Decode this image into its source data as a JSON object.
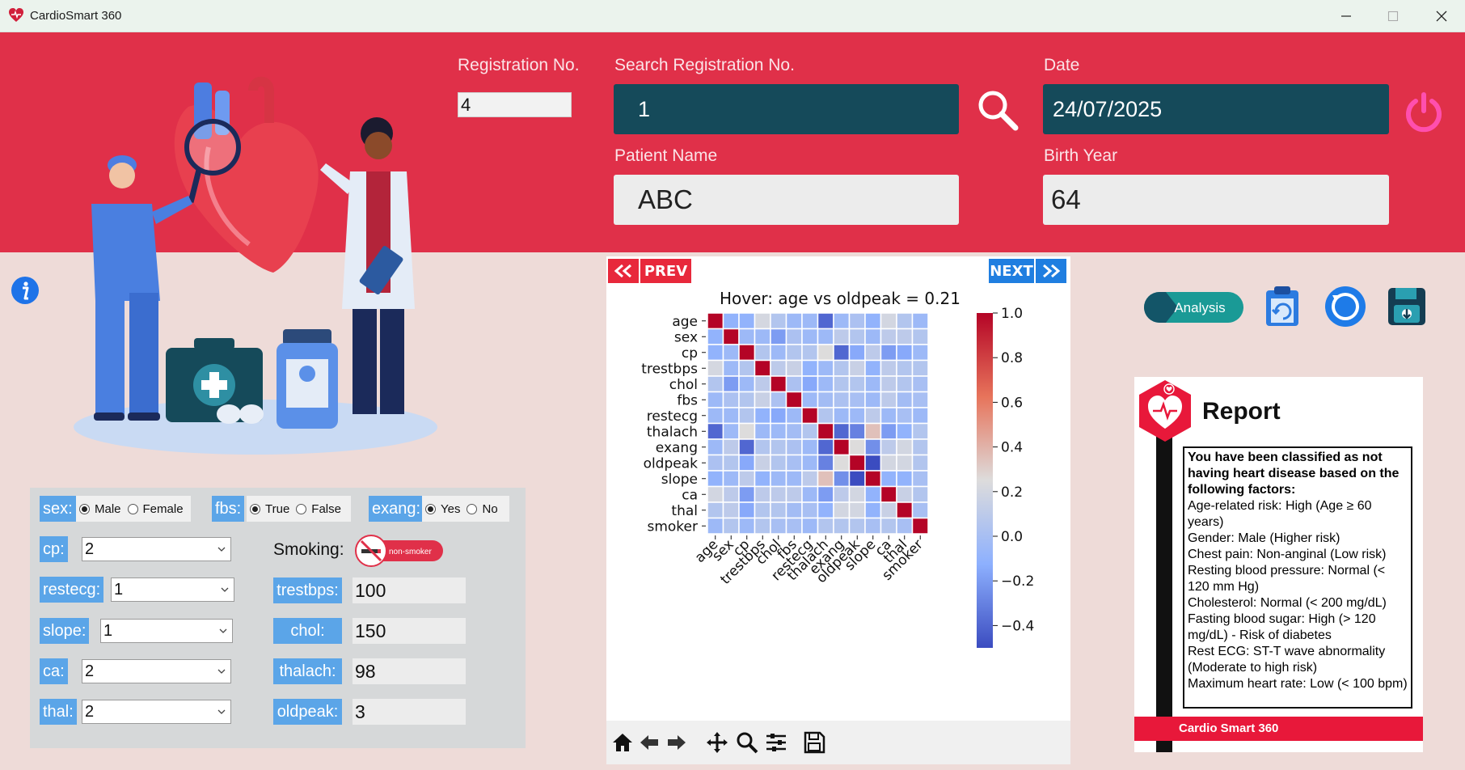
{
  "window": {
    "title": "CardioSmart 360"
  },
  "header": {
    "registration_label": "Registration No.",
    "registration_value": "4",
    "search_label": "Search Registration No.",
    "search_value": "1",
    "date_label": "Date",
    "date_value": "24/07/2025",
    "patient_name_label": "Patient Name",
    "patient_name_value": "ABC",
    "birth_year_label": "Birth Year",
    "birth_year_value": "64"
  },
  "form": {
    "sex": {
      "label": "sex:",
      "options": [
        "Male",
        "Female"
      ],
      "selected": "Male"
    },
    "fbs": {
      "label": "fbs:",
      "options": [
        "True",
        "False"
      ],
      "selected": "True"
    },
    "exang": {
      "label": "exang:",
      "options": [
        "Yes",
        "No"
      ],
      "selected": "Yes"
    },
    "cp": {
      "label": "cp:",
      "value": "2"
    },
    "restecg": {
      "label": "restecg:",
      "value": "1"
    },
    "slope": {
      "label": "slope:",
      "value": "1"
    },
    "ca": {
      "label": "ca:",
      "value": "2"
    },
    "thal": {
      "label": "thal:",
      "value": "2"
    },
    "smoking": {
      "label": "Smoking:",
      "toggle_text": "non-smoker"
    },
    "trestbps": {
      "label": "trestbps:",
      "value": "100"
    },
    "chol": {
      "label": "chol:",
      "value": "150"
    },
    "thalach": {
      "label": "thalach:",
      "value": "98"
    },
    "oldpeak": {
      "label": "oldpeak:",
      "value": "3"
    }
  },
  "chart_nav": {
    "prev_label": "PREV",
    "next_label": "NEXT"
  },
  "chart_data": {
    "type": "heatmap",
    "title": "Hover: age vs oldpeak = 0.21",
    "labels": [
      "age",
      "sex",
      "cp",
      "trestbps",
      "chol",
      "fbs",
      "restecg",
      "thalach",
      "exang",
      "oldpeak",
      "slope",
      "ca",
      "thal",
      "smoker"
    ],
    "colorbar_ticks": [
      "1.0",
      "0.8",
      "0.6",
      "0.4",
      "0.2",
      "0.0",
      "−0.2",
      "−0.4"
    ],
    "vmin": -0.5,
    "vmax": 1.0,
    "colormap": "coolwarm",
    "matrix": [
      [
        1.0,
        -0.1,
        -0.1,
        0.21,
        0.05,
        -0.05,
        -0.05,
        -0.4,
        -0.05,
        0.02,
        -0.1,
        0.2,
        0.05,
        -0.05
      ],
      [
        -0.1,
        1.0,
        -0.05,
        -0.05,
        -0.2,
        0.02,
        -0.05,
        -0.05,
        0.1,
        0.05,
        -0.05,
        0.1,
        0.1,
        0.05
      ],
      [
        -0.1,
        -0.05,
        1.0,
        0.05,
        -0.05,
        0.05,
        0.05,
        0.25,
        -0.4,
        -0.15,
        0.1,
        -0.2,
        -0.15,
        -0.05
      ],
      [
        0.21,
        -0.05,
        0.05,
        1.0,
        0.1,
        0.15,
        -0.1,
        -0.05,
        0.05,
        0.15,
        -0.1,
        0.1,
        0.05,
        0.05
      ],
      [
        0.05,
        -0.2,
        -0.05,
        0.1,
        1.0,
        0.02,
        -0.15,
        -0.05,
        0.05,
        0.05,
        -0.05,
        0.1,
        0.05,
        0.0
      ],
      [
        -0.05,
        0.02,
        0.05,
        0.15,
        0.02,
        1.0,
        -0.05,
        -0.02,
        0.02,
        0.0,
        -0.05,
        0.1,
        -0.02,
        0.0
      ],
      [
        -0.05,
        -0.05,
        0.05,
        -0.1,
        -0.15,
        -0.05,
        1.0,
        0.05,
        -0.05,
        -0.05,
        0.1,
        -0.05,
        0.0,
        -0.05
      ],
      [
        -0.4,
        -0.05,
        0.25,
        -0.05,
        -0.05,
        -0.02,
        0.05,
        1.0,
        -0.4,
        -0.3,
        0.35,
        -0.2,
        -0.1,
        0.05
      ],
      [
        -0.05,
        0.1,
        -0.4,
        0.05,
        0.05,
        0.02,
        -0.05,
        -0.4,
        1.0,
        0.25,
        -0.25,
        0.1,
        0.2,
        0.05
      ],
      [
        0.02,
        0.05,
        -0.15,
        0.15,
        0.05,
        0.0,
        -0.05,
        -0.3,
        0.25,
        1.0,
        -0.55,
        0.2,
        0.2,
        0.05
      ],
      [
        -0.1,
        -0.05,
        0.1,
        -0.1,
        -0.05,
        -0.05,
        0.1,
        0.35,
        -0.25,
        -0.55,
        1.0,
        -0.1,
        -0.1,
        0.0
      ],
      [
        0.2,
        0.1,
        -0.2,
        0.1,
        0.1,
        0.1,
        -0.05,
        -0.2,
        0.1,
        0.2,
        -0.1,
        1.0,
        0.15,
        0.05
      ],
      [
        0.05,
        0.1,
        -0.15,
        0.05,
        0.05,
        -0.02,
        0.0,
        -0.1,
        0.2,
        0.2,
        -0.1,
        0.15,
        1.0,
        0.0
      ],
      [
        -0.05,
        0.05,
        -0.05,
        0.05,
        0.0,
        0.0,
        -0.05,
        0.05,
        0.05,
        0.05,
        0.0,
        0.05,
        0.0,
        1.0
      ]
    ]
  },
  "actions": {
    "analysis_label": "Analysis"
  },
  "report": {
    "title": "Report",
    "summary": "You have been classified as not having heart disease based on the following factors:",
    "factors": [
      "Age-related risk: High (Age ≥ 60 years)",
      "Gender: Male (Higher risk)",
      "Chest pain: Non-anginal (Low risk)",
      "Resting blood pressure: Normal (< 120 mm Hg)",
      "Cholesterol: Normal (< 200 mg/dL)",
      "Fasting blood sugar: High (> 120 mg/dL) - Risk of diabetes",
      "Rest ECG: ST-T wave abnormality (Moderate to high risk)",
      "Maximum heart rate: Low (< 100 bpm)"
    ],
    "footer": "Cardio Smart 360"
  },
  "colors": {
    "header_red": "#e03049",
    "dark_teal": "#154a5a",
    "chip_blue": "#5ba5e8",
    "report_red": "#e8183a"
  }
}
